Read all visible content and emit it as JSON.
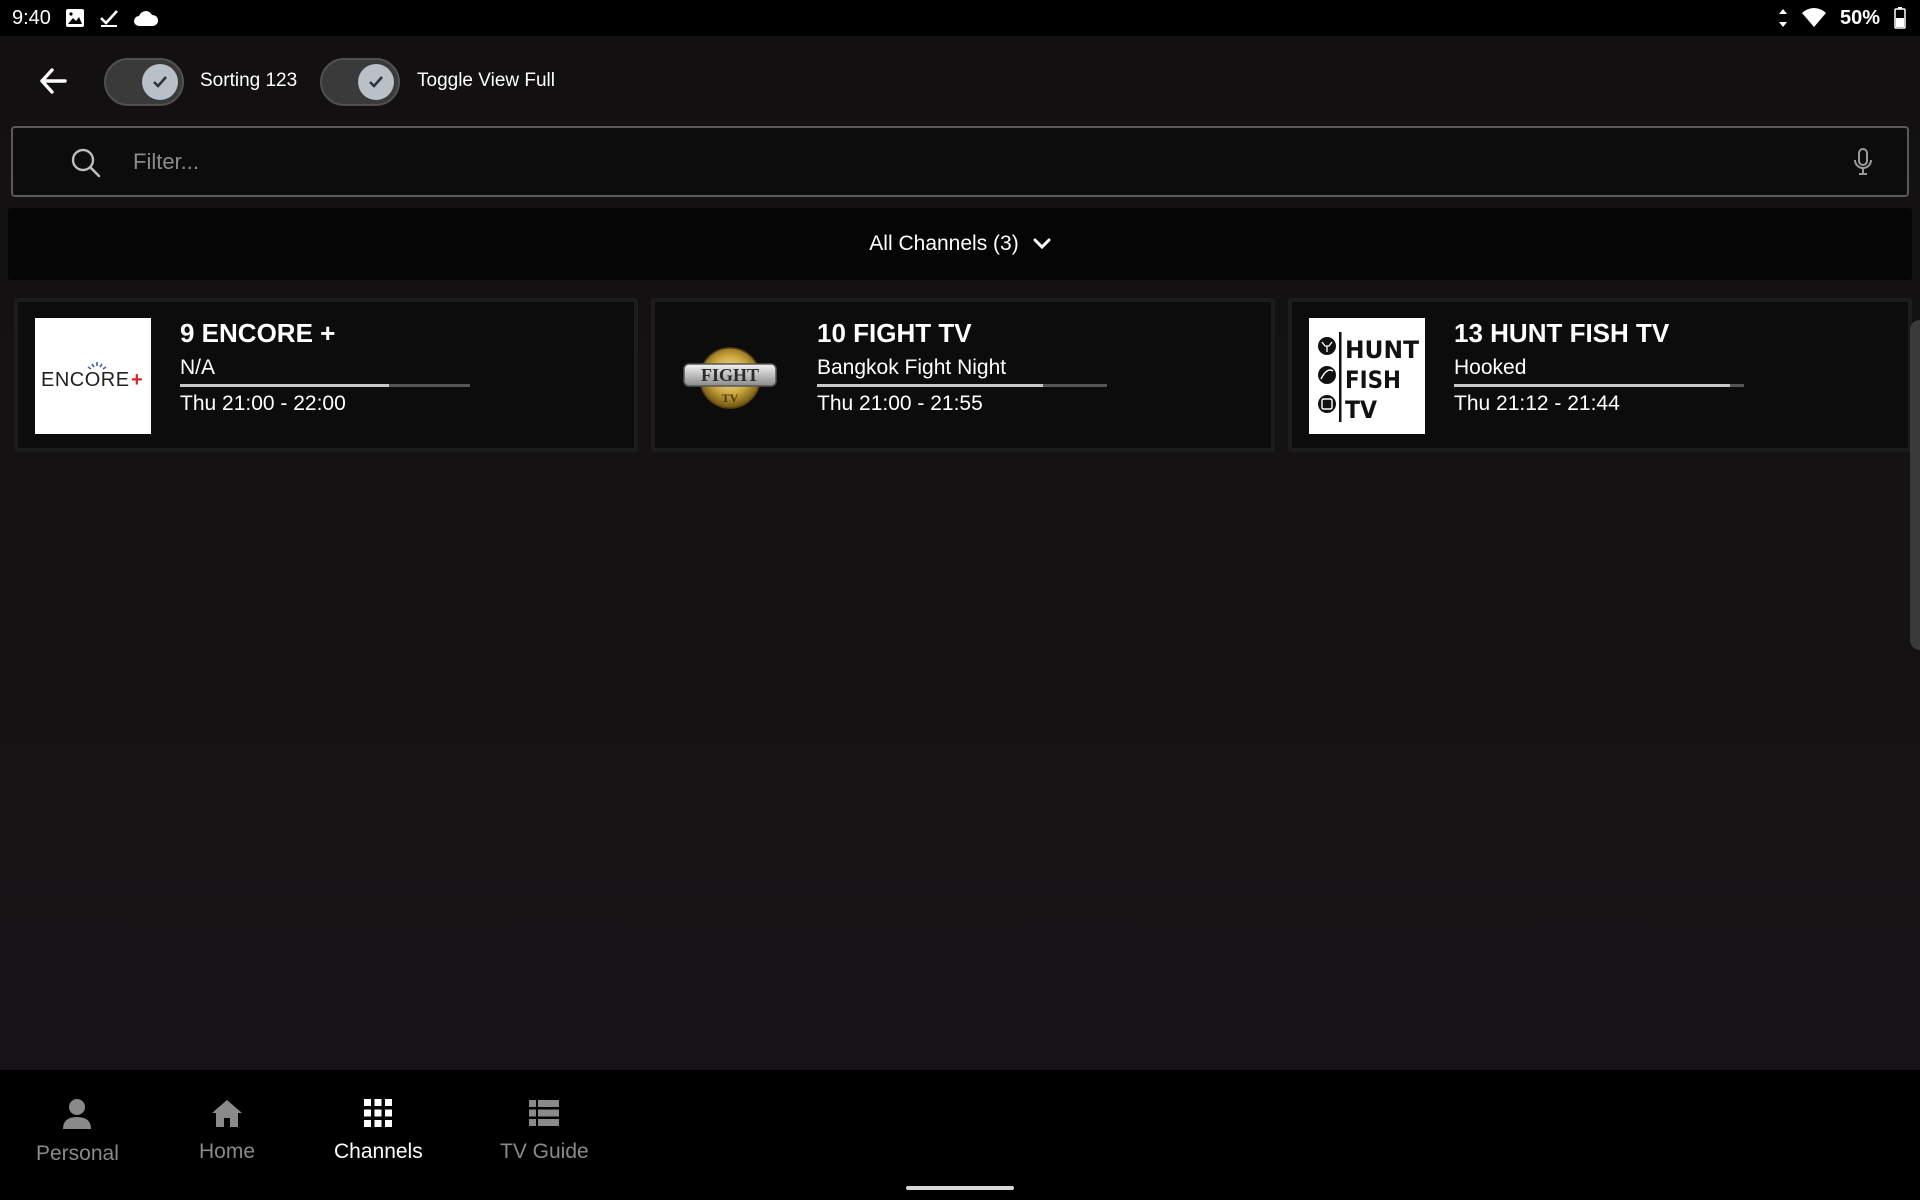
{
  "status_bar": {
    "time": "9:40",
    "left_icons": [
      "image-icon",
      "check-download-icon",
      "cloud-icon"
    ],
    "right_icons": [
      "data-arrows-icon",
      "wifi-icon",
      "battery-icon"
    ],
    "battery_text": "50%"
  },
  "toolbar": {
    "back_icon": "arrow-left-icon",
    "sorting_label": "Sorting 123",
    "toggle_view_label": "Toggle View Full"
  },
  "search": {
    "placeholder": "Filter...",
    "value": ""
  },
  "category": {
    "label": "All Channels (3)"
  },
  "channels": [
    {
      "title": "9 ENCORE +",
      "program": "N/A",
      "time": "Thu 21:00 - 22:00",
      "logo_text": "ENCORE+",
      "progress": 0.72
    },
    {
      "title": "10 FIGHT TV",
      "program": "Bangkok Fight Night",
      "time": "Thu 21:00 - 21:55",
      "logo_text": "FIGHT TV",
      "progress": 0.78
    },
    {
      "title": "13 HUNT FISH TV",
      "program": "Hooked",
      "time": "Thu 21:12 - 21:44",
      "logo_text": "HUNT FISH TV",
      "progress": 0.95
    }
  ],
  "bottom_nav": {
    "items": [
      {
        "label": "Personal",
        "icon": "person-icon",
        "active": false
      },
      {
        "label": "Home",
        "icon": "home-icon",
        "active": false
      },
      {
        "label": "Channels",
        "icon": "grid-icon",
        "active": true
      },
      {
        "label": "TV Guide",
        "icon": "list-icon",
        "active": false
      }
    ]
  },
  "colors": {
    "background": "#141212",
    "status_bar": "#000000",
    "nav_active": "#ffffff",
    "nav_inactive": "#8a8a8a",
    "toggle_knob": "#b9c0c8"
  }
}
